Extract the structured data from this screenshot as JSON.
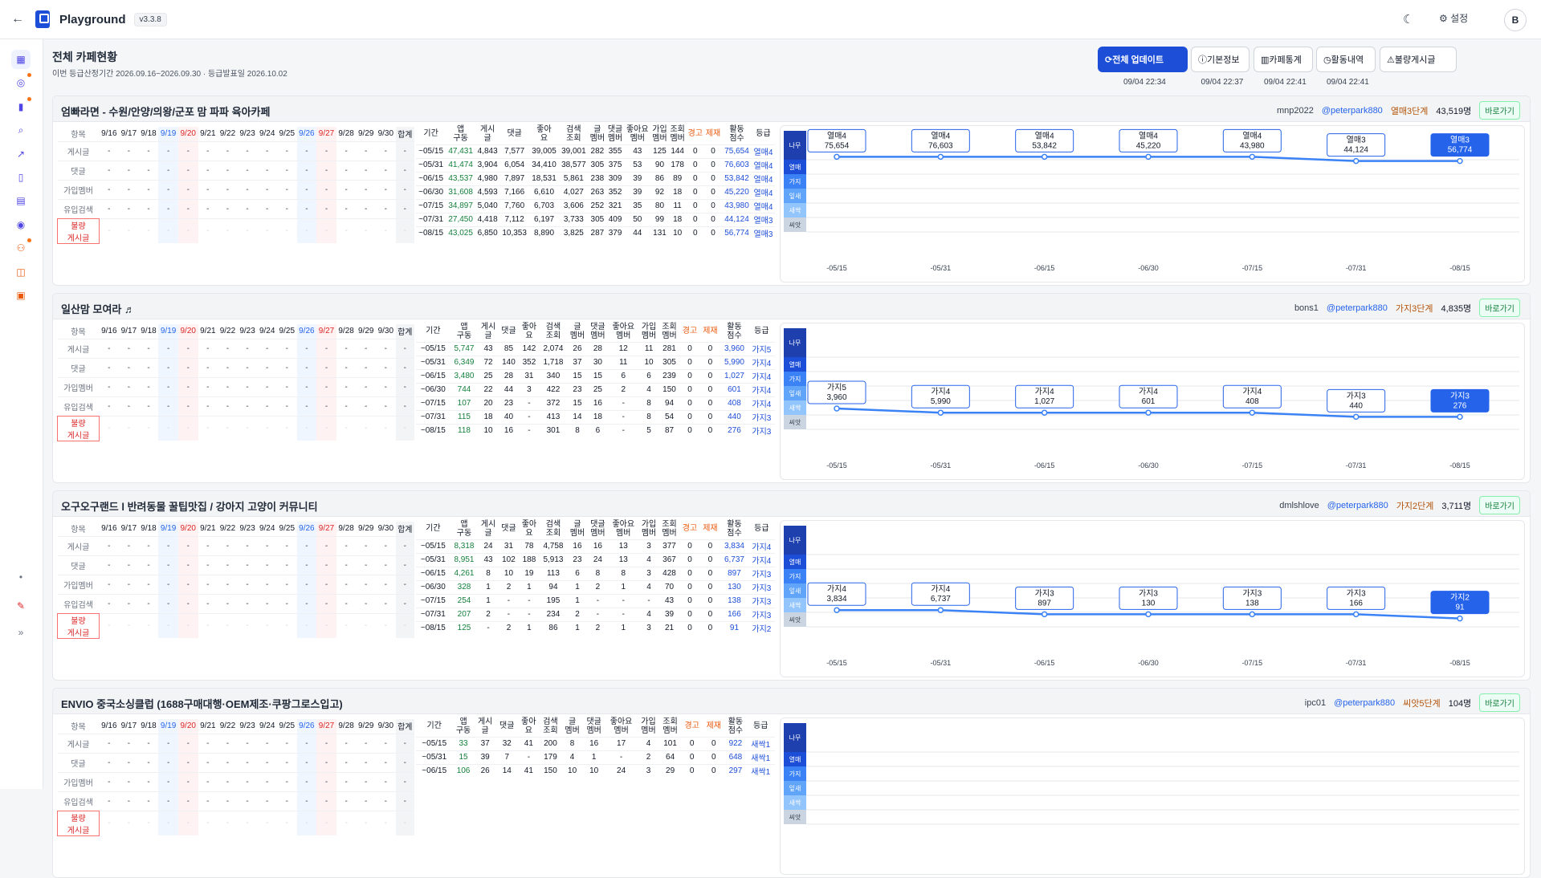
{
  "app": {
    "title": "Playground",
    "version": "v3.3.8",
    "settings_label": "설정",
    "user_initial": "B"
  },
  "page": {
    "title": "전체 카페현황",
    "subtitle": "이번 등급산정기간 2026.09.16~2026.09.30 · 등급발표일 2026.10.02"
  },
  "header_buttons": [
    {
      "label": "전체 업데이트",
      "time": "09/04 22:34",
      "icon": "refresh-icon"
    },
    {
      "label": "기본정보",
      "time": "09/04 22:37",
      "icon": "info-icon"
    },
    {
      "label": "카페통계",
      "time": "09/04 22:41",
      "icon": "bar-chart-icon"
    },
    {
      "label": "활동내역",
      "time": "09/04 22:41",
      "icon": "clock-icon"
    },
    {
      "label": "불량게시글",
      "time": "",
      "icon": "warning-icon"
    }
  ],
  "colors": {
    "accent": "#1d4ed8",
    "app_count": "#15803d",
    "grade": "#1d4ed8",
    "warning": "#ea580c",
    "bad": "#dc2626"
  },
  "labels": {
    "item": "항목",
    "total": "합계",
    "rows": [
      "게시글",
      "댓글",
      "가입멤버",
      "유입검색"
    ],
    "bad_row": "불량\n게시글",
    "metrics": [
      "기간",
      "앱\n구동",
      "게시\n글",
      "댓글",
      "좋아\n요",
      "검색\n조회",
      "글\n멤버",
      "댓글\n멤버",
      "좋아요\n멤버",
      "가입\n멤버",
      "조회\n멤버",
      "경고",
      "제재",
      "활동\n점수",
      "등급"
    ],
    "goto": "바로가기"
  },
  "dates": [
    "9/16",
    "9/17",
    "9/18",
    "9/19",
    "9/20",
    "9/21",
    "9/22",
    "9/23",
    "9/24",
    "9/25",
    "9/26",
    "9/27",
    "9/28",
    "9/29",
    "9/30"
  ],
  "empty": "-",
  "level_labels": [
    "나무",
    "열매",
    "가지",
    "잎새",
    "새싹",
    "씨앗"
  ],
  "cafes": [
    {
      "name": "엄빠라면 - 수원/안양/의왕/군포 맘 파파 육아카페",
      "user": "mnp2022",
      "handle": "@peterpark880",
      "grade": "열매3단계",
      "members": "43,519명",
      "rows": [
        [
          "~05/15",
          "47,431",
          "4,843",
          "7,577",
          "39,005",
          "39,001",
          "282",
          "355",
          "43",
          "125",
          "144",
          "0",
          "0",
          "75,654",
          "열매4"
        ],
        [
          "~05/31",
          "41,474",
          "3,904",
          "6,054",
          "34,410",
          "38,577",
          "305",
          "375",
          "53",
          "90",
          "178",
          "0",
          "0",
          "76,603",
          "열매4"
        ],
        [
          "~06/15",
          "43,537",
          "4,980",
          "7,897",
          "18,531",
          "5,861",
          "238",
          "309",
          "39",
          "86",
          "89",
          "0",
          "0",
          "53,842",
          "열매4"
        ],
        [
          "~06/30",
          "31,608",
          "4,593",
          "7,166",
          "6,610",
          "4,027",
          "263",
          "352",
          "39",
          "92",
          "18",
          "0",
          "0",
          "45,220",
          "열매4"
        ],
        [
          "~07/15",
          "34,897",
          "5,040",
          "7,760",
          "6,703",
          "3,606",
          "252",
          "321",
          "35",
          "80",
          "11",
          "0",
          "0",
          "43,980",
          "열매4"
        ],
        [
          "~07/31",
          "27,450",
          "4,418",
          "7,112",
          "6,197",
          "3,733",
          "305",
          "409",
          "50",
          "99",
          "18",
          "0",
          "0",
          "44,124",
          "열매3"
        ],
        [
          "~08/15",
          "43,025",
          "6,850",
          "10,353",
          "8,890",
          "3,825",
          "287",
          "379",
          "44",
          "131",
          "10",
          "0",
          "0",
          "56,774",
          "열매3"
        ]
      ],
      "chart_data": {
        "type": "line",
        "x": [
          "~05/15",
          "~05/31",
          "~06/15",
          "~06/30",
          "~07/15",
          "~07/31",
          "~08/15"
        ],
        "grades": [
          "열매4",
          "열매4",
          "열매4",
          "열매4",
          "열매4",
          "열매3",
          "열매3"
        ],
        "scores": [
          "75,654",
          "76,603",
          "53,842",
          "45,220",
          "43,980",
          "44,124",
          "56,774"
        ],
        "level": [
          4.8,
          4.8,
          4.8,
          4.8,
          4.8,
          4.7,
          4.7
        ]
      }
    },
    {
      "name": "일산맘 모여라 ♬",
      "user": "bons1",
      "handle": "@peterpark880",
      "grade": "가지3단계",
      "members": "4,835명",
      "rows": [
        [
          "~05/15",
          "5,747",
          "43",
          "85",
          "142",
          "2,074",
          "26",
          "28",
          "12",
          "11",
          "281",
          "0",
          "0",
          "3,960",
          "가지5"
        ],
        [
          "~05/31",
          "6,349",
          "72",
          "140",
          "352",
          "1,718",
          "37",
          "30",
          "11",
          "10",
          "305",
          "0",
          "0",
          "5,990",
          "가지4"
        ],
        [
          "~06/15",
          "3,480",
          "25",
          "28",
          "31",
          "340",
          "15",
          "15",
          "6",
          "6",
          "239",
          "0",
          "0",
          "1,027",
          "가지4"
        ],
        [
          "~06/30",
          "744",
          "22",
          "44",
          "3",
          "422",
          "23",
          "25",
          "2",
          "4",
          "150",
          "0",
          "0",
          "601",
          "가지4"
        ],
        [
          "~07/15",
          "107",
          "20",
          "23",
          "-",
          "372",
          "15",
          "16",
          "-",
          "8",
          "94",
          "0",
          "0",
          "408",
          "가지4"
        ],
        [
          "~07/31",
          "115",
          "18",
          "40",
          "-",
          "413",
          "14",
          "18",
          "-",
          "8",
          "54",
          "0",
          "0",
          "440",
          "가지3"
        ],
        [
          "~08/15",
          "118",
          "10",
          "16",
          "-",
          "301",
          "8",
          "6",
          "-",
          "5",
          "87",
          "0",
          "0",
          "276",
          "가지3"
        ]
      ],
      "chart_data": {
        "type": "line",
        "x": [
          "~05/15",
          "~05/31",
          "~06/15",
          "~06/30",
          "~07/15",
          "~07/31",
          "~08/15"
        ],
        "grades": [
          "가지5",
          "가지4",
          "가지4",
          "가지4",
          "가지4",
          "가지3",
          "가지3"
        ],
        "scores": [
          "3,960",
          "5,990",
          "1,027",
          "601",
          "408",
          "440",
          "276"
        ],
        "level": [
          3.5,
          3.4,
          3.4,
          3.4,
          3.4,
          3.3,
          3.3
        ]
      }
    },
    {
      "name": "오구오구랜드 l 반려동물 꿀팁맛집 / 강아지 고양이 커뮤니티",
      "user": "dmlshlove",
      "handle": "@peterpark880",
      "grade": "가지2단계",
      "members": "3,711명",
      "rows": [
        [
          "~05/15",
          "8,318",
          "24",
          "31",
          "78",
          "4,758",
          "16",
          "16",
          "13",
          "3",
          "377",
          "0",
          "0",
          "3,834",
          "가지4"
        ],
        [
          "~05/31",
          "8,951",
          "43",
          "102",
          "188",
          "5,913",
          "23",
          "24",
          "13",
          "4",
          "367",
          "0",
          "0",
          "6,737",
          "가지4"
        ],
        [
          "~06/15",
          "4,261",
          "8",
          "10",
          "19",
          "113",
          "6",
          "8",
          "8",
          "3",
          "428",
          "0",
          "0",
          "897",
          "가지3"
        ],
        [
          "~06/30",
          "328",
          "1",
          "2",
          "1",
          "94",
          "1",
          "2",
          "1",
          "4",
          "70",
          "0",
          "0",
          "130",
          "가지3"
        ],
        [
          "~07/15",
          "254",
          "1",
          "-",
          "-",
          "195",
          "1",
          "-",
          "-",
          "-",
          "43",
          "0",
          "0",
          "138",
          "가지3"
        ],
        [
          "~07/31",
          "207",
          "2",
          "-",
          "-",
          "234",
          "2",
          "-",
          "-",
          "4",
          "39",
          "0",
          "0",
          "166",
          "가지3"
        ],
        [
          "~08/15",
          "125",
          "-",
          "2",
          "1",
          "86",
          "1",
          "2",
          "1",
          "3",
          "21",
          "0",
          "0",
          "91",
          "가지2"
        ]
      ],
      "chart_data": {
        "type": "line",
        "x": [
          "~05/15",
          "~05/31",
          "~06/15",
          "~06/30",
          "~07/15",
          "~07/31",
          "~08/15"
        ],
        "grades": [
          "가지4",
          "가지4",
          "가지3",
          "가지3",
          "가지3",
          "가지3",
          "가지2"
        ],
        "scores": [
          "3,834",
          "6,737",
          "897",
          "130",
          "138",
          "166",
          "91"
        ],
        "level": [
          3.4,
          3.4,
          3.3,
          3.3,
          3.3,
          3.3,
          3.2
        ]
      }
    },
    {
      "name": "ENVIO 중국소싱클럽 (1688구매대행·OEM제조·쿠팡그로스입고)",
      "user": "ipc01",
      "handle": "@peterpark880",
      "grade": "씨앗5단계",
      "members": "104명",
      "rows": [
        [
          "~05/15",
          "33",
          "37",
          "32",
          "41",
          "200",
          "8",
          "16",
          "17",
          "4",
          "101",
          "0",
          "0",
          "922",
          "새싹1"
        ],
        [
          "~05/31",
          "15",
          "39",
          "7",
          "-",
          "179",
          "4",
          "1",
          "-",
          "2",
          "64",
          "0",
          "0",
          "648",
          "새싹1"
        ],
        [
          "~06/15",
          "106",
          "26",
          "14",
          "41",
          "150",
          "10",
          "10",
          "24",
          "3",
          "29",
          "0",
          "0",
          "297",
          "새싹1"
        ]
      ],
      "chart_data": {
        "type": "line",
        "x": [],
        "grades": [],
        "scores": [],
        "level": []
      }
    }
  ]
}
